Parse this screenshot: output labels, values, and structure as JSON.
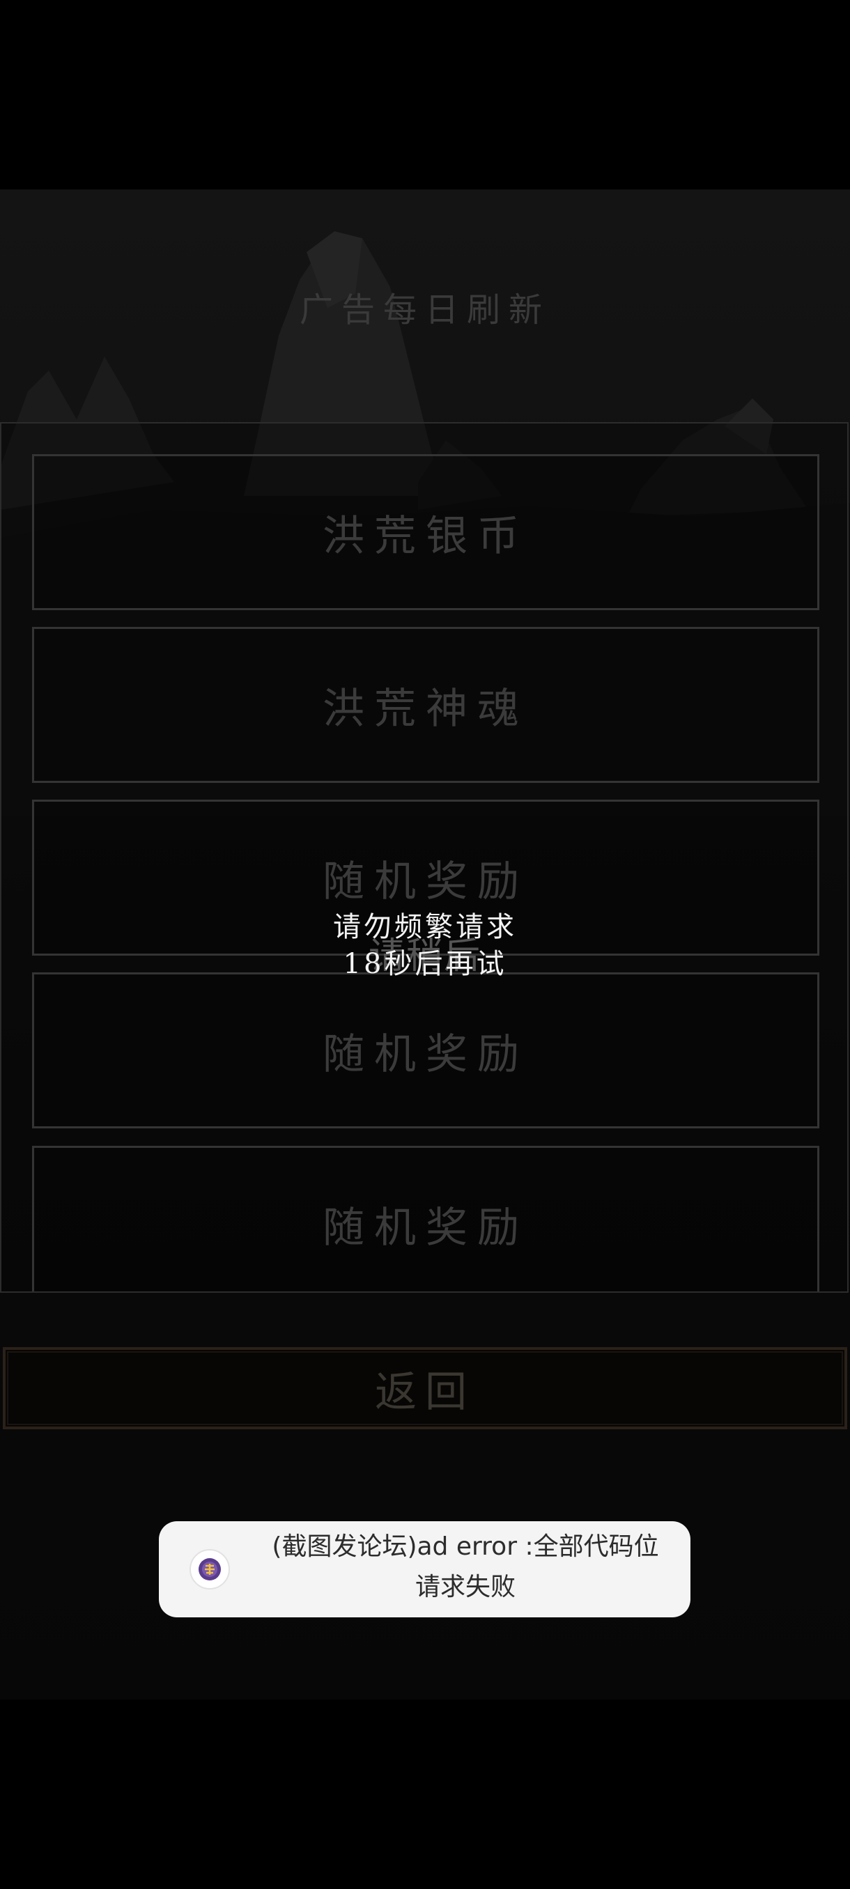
{
  "header": {
    "title": "广告每日刷新"
  },
  "rewards": [
    {
      "label": "洪荒银币"
    },
    {
      "label": "洪荒神魂"
    },
    {
      "label": "随机奖励"
    },
    {
      "label": "随机奖励"
    },
    {
      "label": "随机奖励"
    }
  ],
  "back_button": {
    "label": "返回"
  },
  "popup": {
    "line1": "请勿频繁请求",
    "line2": "18秒后再试",
    "ghost_text": "请稍后"
  },
  "toast": {
    "icon": "app-logo-icon",
    "line1": "(截图发论坛)ad error :全部代码位",
    "line2": "请求失败"
  }
}
